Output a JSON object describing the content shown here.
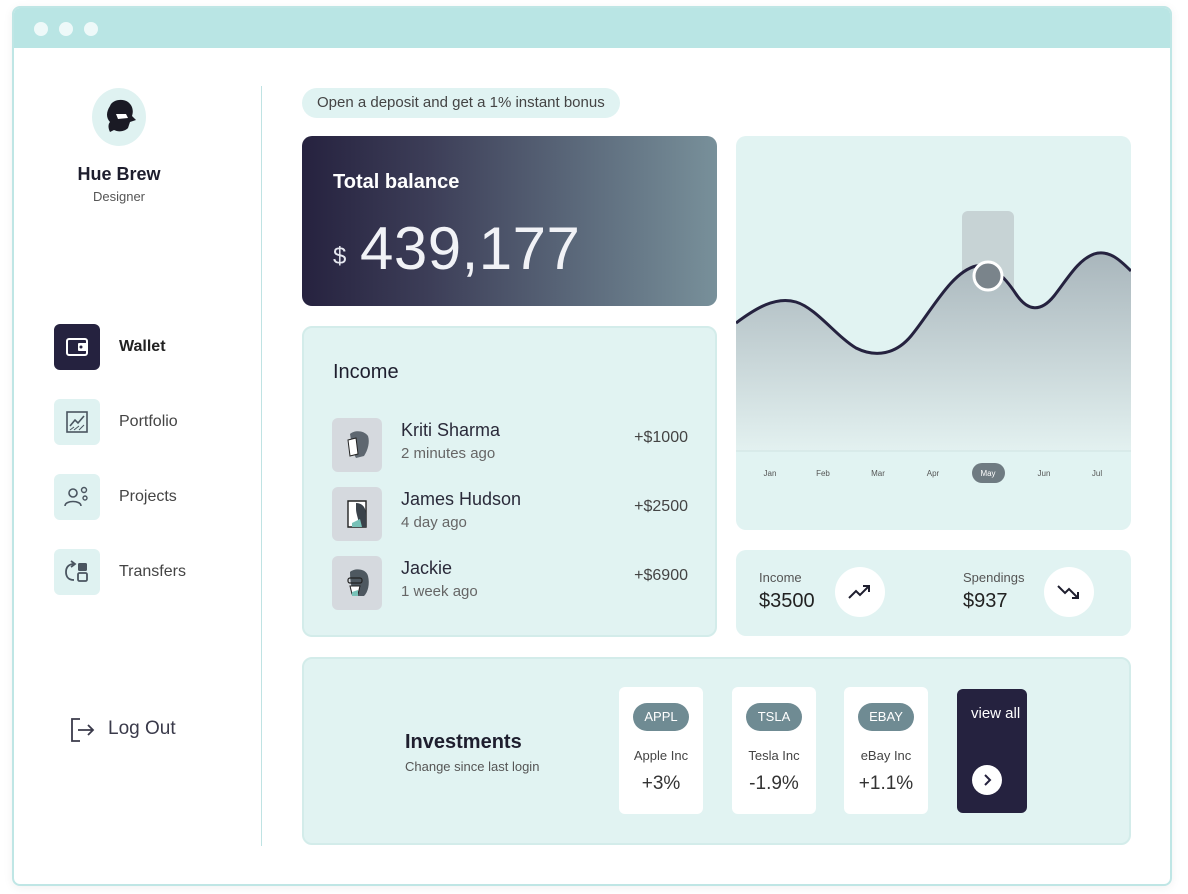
{
  "profile": {
    "name": "Hue Brew",
    "role": "Designer"
  },
  "nav": [
    {
      "label": "Wallet",
      "icon": "wallet-icon",
      "active": true
    },
    {
      "label": "Portfolio",
      "icon": "chart-icon",
      "active": false
    },
    {
      "label": "Projects",
      "icon": "team-gear-icon",
      "active": false
    },
    {
      "label": "Transfers",
      "icon": "transfer-icon",
      "active": false
    }
  ],
  "logout": {
    "label": "Log Out"
  },
  "promo": "Open a deposit and get a 1% instant bonus",
  "balance": {
    "title": "Total balance",
    "currency": "$",
    "value": "439,177"
  },
  "income": {
    "title": "Income",
    "rows": [
      {
        "name": "Kriti Sharma",
        "time": "2 minutes ago",
        "amount": "+$1000"
      },
      {
        "name": "James Hudson",
        "time": "4 day ago",
        "amount": "+$2500"
      },
      {
        "name": "Jackie",
        "time": "1 week ago",
        "amount": "+$6900"
      }
    ]
  },
  "chart_data": {
    "type": "area",
    "categories": [
      "Jan",
      "Feb",
      "Mar",
      "Apr",
      "May",
      "Jun",
      "Jul"
    ],
    "selected": "May",
    "grid": false
  },
  "stats": {
    "income": {
      "label": "Income",
      "value": "$3500",
      "icon": "trending-up-icon"
    },
    "spendings": {
      "label": "Spendings",
      "value": "$937",
      "icon": "trending-down-icon"
    }
  },
  "investments": {
    "title": "Investments",
    "subtitle": "Change since last login",
    "stocks": [
      {
        "ticker": "APPL",
        "name": "Apple Inc",
        "change": "+3%"
      },
      {
        "ticker": "TSLA",
        "name": "Tesla Inc",
        "change": "-1.9%"
      },
      {
        "ticker": "EBAY",
        "name": "eBay Inc",
        "change": "+1.1%"
      }
    ],
    "view_all": "view all"
  },
  "colors": {
    "accent_dark": "#25223f",
    "mint": "#e1f3f2",
    "titlebar": "#b9e5e4"
  }
}
